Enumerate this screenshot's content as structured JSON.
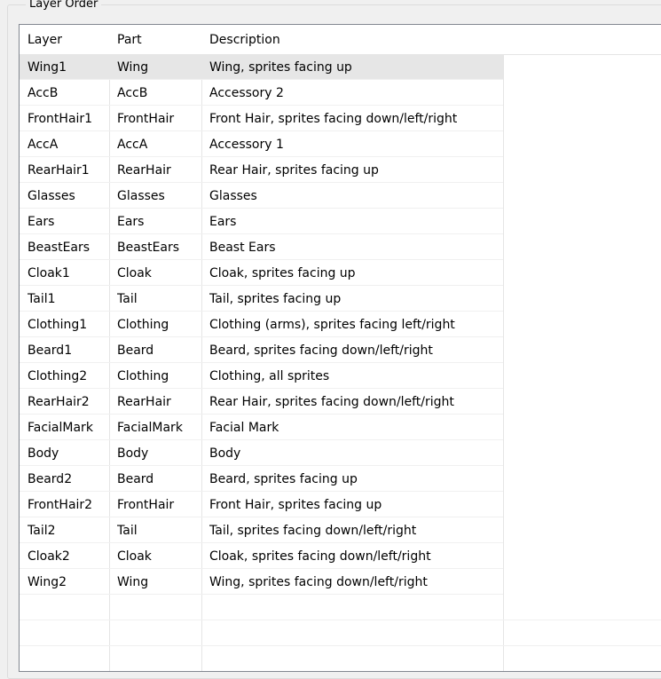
{
  "group": {
    "title": "Layer Order"
  },
  "table": {
    "columns": [
      "Layer",
      "Part",
      "Description"
    ],
    "selected_index": 0,
    "rows": [
      {
        "layer": "Wing1",
        "part": "Wing",
        "description": "Wing, sprites facing up"
      },
      {
        "layer": "AccB",
        "part": "AccB",
        "description": "Accessory 2"
      },
      {
        "layer": "FrontHair1",
        "part": "FrontHair",
        "description": "Front Hair, sprites facing down/left/right"
      },
      {
        "layer": "AccA",
        "part": "AccA",
        "description": "Accessory 1"
      },
      {
        "layer": "RearHair1",
        "part": "RearHair",
        "description": "Rear Hair, sprites facing up"
      },
      {
        "layer": "Glasses",
        "part": "Glasses",
        "description": "Glasses"
      },
      {
        "layer": "Ears",
        "part": "Ears",
        "description": "Ears"
      },
      {
        "layer": "BeastEars",
        "part": "BeastEars",
        "description": "Beast Ears"
      },
      {
        "layer": "Cloak1",
        "part": "Cloak",
        "description": "Cloak, sprites facing up"
      },
      {
        "layer": "Tail1",
        "part": "Tail",
        "description": "Tail, sprites facing up"
      },
      {
        "layer": "Clothing1",
        "part": "Clothing",
        "description": "Clothing (arms), sprites facing left/right"
      },
      {
        "layer": "Beard1",
        "part": "Beard",
        "description": "Beard, sprites facing down/left/right"
      },
      {
        "layer": "Clothing2",
        "part": "Clothing",
        "description": "Clothing, all sprites"
      },
      {
        "layer": "RearHair2",
        "part": "RearHair",
        "description": "Rear Hair, sprites facing down/left/right"
      },
      {
        "layer": "FacialMark",
        "part": "FacialMark",
        "description": "Facial Mark"
      },
      {
        "layer": "Body",
        "part": "Body",
        "description": "Body"
      },
      {
        "layer": "Beard2",
        "part": "Beard",
        "description": "Beard, sprites facing up"
      },
      {
        "layer": "FrontHair2",
        "part": "FrontHair",
        "description": "Front Hair, sprites facing up"
      },
      {
        "layer": "Tail2",
        "part": "Tail",
        "description": "Tail, sprites facing down/left/right"
      },
      {
        "layer": "Cloak2",
        "part": "Cloak",
        "description": "Cloak, sprites facing down/left/right"
      },
      {
        "layer": "Wing2",
        "part": "Wing",
        "description": "Wing, sprites facing down/left/right"
      }
    ]
  },
  "colors": {
    "selected_row": "#e6e6e6",
    "gridline": "#e5e5e5",
    "background": "#f0f0f0"
  }
}
